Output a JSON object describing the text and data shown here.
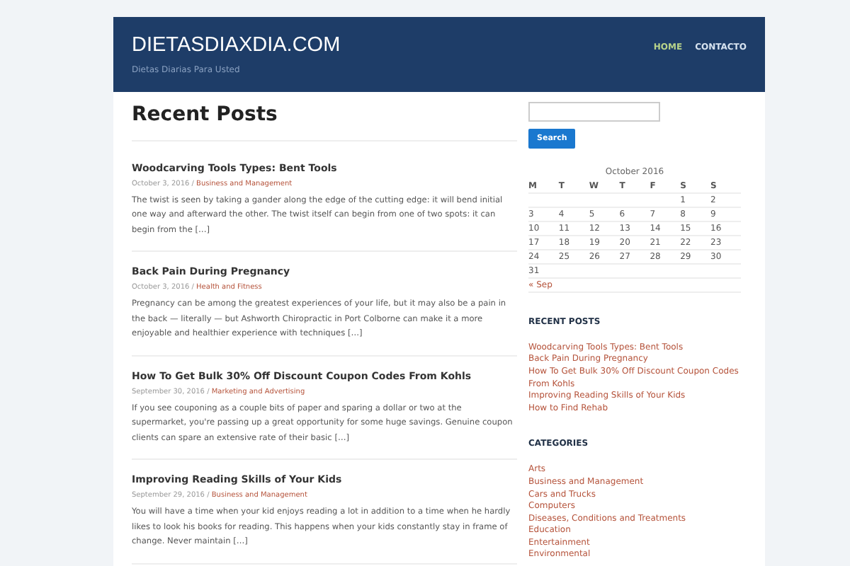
{
  "site": {
    "title": "DIETASDIAXDIA.COM",
    "tagline": "Dietas Diarias Para Usted"
  },
  "nav": [
    {
      "label": "HOME",
      "selected": true
    },
    {
      "label": "CONTACTO",
      "selected": false
    }
  ],
  "main": {
    "heading": "Recent Posts",
    "posts": [
      {
        "title": "Woodcarving Tools Types: Bent Tools",
        "date": "October 3, 2016",
        "separator": "/",
        "category": "Business and Management",
        "excerpt": "The twist is seen by taking a gander along the edge of the cutting edge: it will bend initial one way and afterward the other. The twist itself can begin from one of two spots: it can begin from the […]"
      },
      {
        "title": "Back Pain During Pregnancy",
        "date": "October 3, 2016",
        "separator": "/",
        "category": "Health and Fitness",
        "excerpt": "Pregnancy can be among the greatest experiences of your life, but it may also be a pain in the back — literally — but Ashworth Chiropractic in Port Colborne can make it a more enjoyable and healthier experience with techniques […]"
      },
      {
        "title": "How To Get Bulk 30% Off Discount Coupon Codes From Kohls",
        "date": "September 30, 2016",
        "separator": "/",
        "category": "Marketing and Advertising",
        "excerpt": "If you see couponing as a couple bits of paper and sparing a dollar or two at the supermarket, you're passing up a great opportunity for some huge savings. Genuine coupon clients can spare an extensive rate of their basic […]"
      },
      {
        "title": "Improving Reading Skills of Your Kids",
        "date": "September 29, 2016",
        "separator": "/",
        "category": "Business and Management",
        "excerpt": "You will have a time when your kid enjoys reading a lot in addition to a time when he hardly likes to look his books for reading. This happens when your kids constantly stay in frame of change. Never maintain […]"
      }
    ]
  },
  "sidebar": {
    "search_button": "Search",
    "calendar": {
      "caption": "October 2016",
      "headers": [
        "M",
        "T",
        "W",
        "T",
        "F",
        "S",
        "S"
      ],
      "weeks": [
        {
          "starts_midweek": true,
          "days": [
            "1",
            "2"
          ]
        },
        {
          "starts_midweek": false,
          "days": [
            "3",
            "4",
            "5",
            "6",
            "7",
            "8",
            "9"
          ]
        },
        {
          "starts_midweek": false,
          "days": [
            "10",
            "11",
            "12",
            "13",
            "14",
            "15",
            "16"
          ]
        },
        {
          "starts_midweek": false,
          "days": [
            "17",
            "18",
            "19",
            "20",
            "21",
            "22",
            "23"
          ]
        },
        {
          "starts_midweek": false,
          "days": [
            "24",
            "25",
            "26",
            "27",
            "28",
            "29",
            "30"
          ]
        },
        {
          "starts_midweek": false,
          "days": [
            "31"
          ]
        }
      ],
      "prev": "« Sep"
    },
    "recent_heading": "RECENT POSTS",
    "recent": [
      "Woodcarving Tools Types: Bent Tools",
      "Back Pain During Pregnancy",
      "How To Get Bulk 30% Off Discount Coupon Codes From Kohls",
      "Improving Reading Skills of Your Kids",
      "How to Find Rehab"
    ],
    "categories_heading": "CATEGORIES",
    "categories": [
      "Arts",
      "Business and Management",
      "Cars and Trucks",
      "Computers",
      "Diseases, Conditions and Treatments",
      "Education",
      "Entertainment",
      "Environmental"
    ]
  }
}
